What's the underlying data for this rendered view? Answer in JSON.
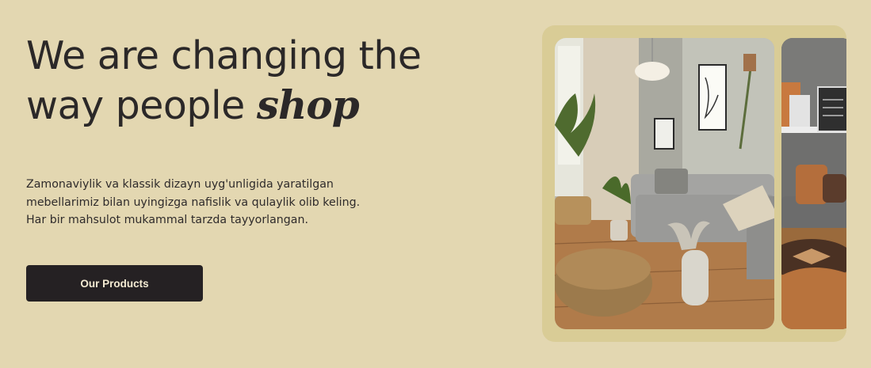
{
  "hero": {
    "headline_part1": "We are changing the",
    "headline_part2": "way people ",
    "headline_script": "shop",
    "description": "Zamonaviylik va klassik dizayn uyg'unligida yaratilgan mebellarimiz bilan uyingizga nafislik va qulaylik olib keling. Har bir mahsulot mukammal tarzda tayyorlangan.",
    "cta_label": "Our Products"
  },
  "colors": {
    "background": "#e3d7b1",
    "gallery_frame": "#d9cc96",
    "button_bg": "#252123",
    "button_text": "#f3ead2",
    "text": "#2a2727"
  }
}
